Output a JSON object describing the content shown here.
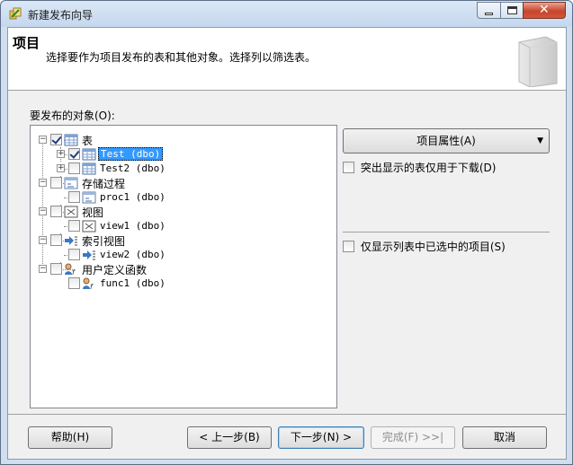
{
  "window": {
    "title": "新建发布向导"
  },
  "header": {
    "title": "项目",
    "description": "选择要作为项目发布的表和其他对象。选择列以筛选表。"
  },
  "objects_label": "要发布的对象(O):",
  "tree": {
    "groups": [
      {
        "label": "表",
        "checked": true,
        "items": [
          {
            "label": "Test (dbo)",
            "checked": true,
            "selected": true
          },
          {
            "label": "Test2 (dbo)",
            "checked": false
          }
        ]
      },
      {
        "label": "存储过程",
        "checked": false,
        "items": [
          {
            "label": "proc1 (dbo)",
            "checked": false
          }
        ]
      },
      {
        "label": "视图",
        "checked": false,
        "items": [
          {
            "label": "view1 (dbo)",
            "checked": false
          }
        ]
      },
      {
        "label": "索引视图",
        "checked": false,
        "items": [
          {
            "label": "view2 (dbo)",
            "checked": false
          }
        ]
      },
      {
        "label": "用户定义函数",
        "checked": false,
        "items": [
          {
            "label": "func1 (dbo)",
            "checked": false
          }
        ]
      }
    ]
  },
  "right_panel": {
    "properties_button": "项目属性(A)",
    "highlight_download_only": "突出显示的表仅用于下载(D)",
    "show_only_selected": "仅显示列表中已选中的项目(S)"
  },
  "footer": {
    "help": "帮助(H)",
    "back": "< 上一步(B)",
    "next": "下一步(N) >",
    "finish": "完成(F) >>|",
    "cancel": "取消"
  },
  "colors": {
    "selection": "#3399ff",
    "title_bar": "#c4d7ee",
    "close_button": "#c7452c"
  }
}
